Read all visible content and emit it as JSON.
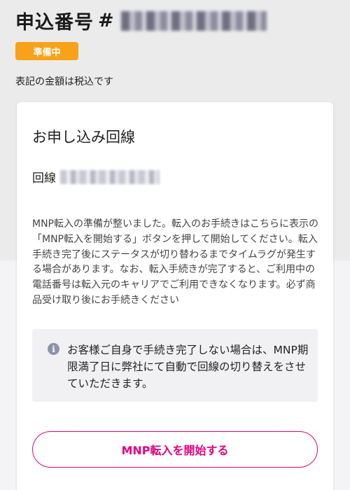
{
  "header": {
    "title": "申込番号",
    "hash": "#"
  },
  "status": {
    "label": "準備中",
    "color": "#f7a218"
  },
  "tax_note": "表記の金額は税込です",
  "card": {
    "title": "お申し込み回線",
    "line_label": "回線",
    "description": "MNP転入の準備が整いました。転入のお手続きはこちらに表示の「MNP転入を開始する」ボタンを押して開始してください。転入手続き完了後にステータスが切り替わるまでタイムラグが発生する場合があります。なお、転入手続きが完了すると、ご利用中の電話番号は転入元のキャリアでご利用できなくなります。必ず商品受け取り後にお手続きください",
    "notice": {
      "icon": "info-icon",
      "icon_glyph": "i",
      "text": "お客様ご自身で手続き完了しない場合は、MNP期限満了日に弊社にて自動で回線の切り替えをさせていただきます。"
    },
    "button": {
      "label": "MNP転入を開始する",
      "color": "#e6007e"
    }
  }
}
